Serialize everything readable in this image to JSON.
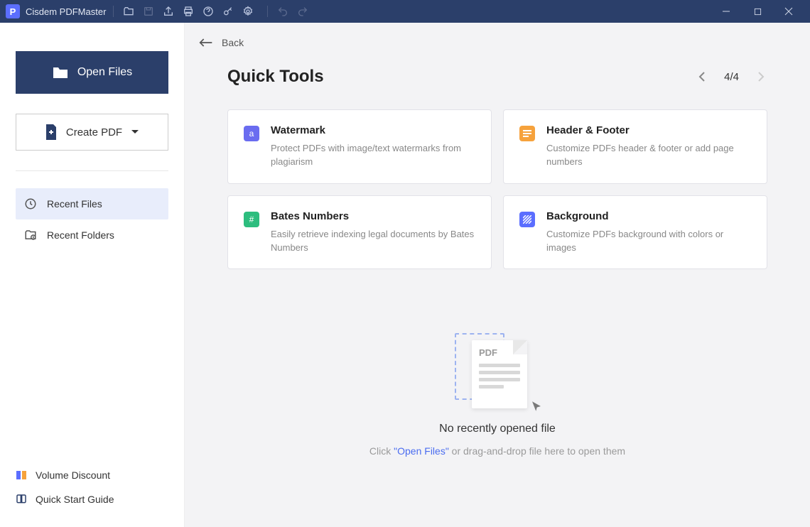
{
  "app": {
    "title": "Cisdem PDFMaster",
    "icon_letter": "P"
  },
  "titlebar_icons": [
    "open-icon",
    "save-icon",
    "share-icon",
    "print-icon",
    "help-icon",
    "upgrade-key-icon",
    "settings-gear-icon",
    "undo-icon",
    "redo-icon"
  ],
  "sidebar": {
    "open_files": "Open Files",
    "create_pdf": "Create PDF",
    "nav": [
      {
        "id": "recent-files",
        "label": "Recent Files",
        "active": true
      },
      {
        "id": "recent-folders",
        "label": "Recent Folders",
        "active": false
      }
    ],
    "bottom": [
      {
        "id": "volume-discount",
        "label": "Volume Discount"
      },
      {
        "id": "quick-start-guide",
        "label": "Quick Start Guide"
      }
    ]
  },
  "main": {
    "back": "Back",
    "heading": "Quick Tools",
    "pager": {
      "current": 4,
      "total": 4,
      "display": "4/4"
    },
    "tools": [
      {
        "id": "watermark",
        "title": "Watermark",
        "desc": "Protect PDFs with image/text watermarks from plagiarism",
        "color": "#6a6cf0",
        "glyph": "a"
      },
      {
        "id": "header-footer",
        "title": "Header & Footer",
        "desc": "Customize PDFs header & footer or add page numbers",
        "color": "#f6a23c",
        "glyph": "≡"
      },
      {
        "id": "bates-numbers",
        "title": "Bates Numbers",
        "desc": "Easily retrieve indexing legal documents by Bates Numbers",
        "color": "#2dbd7e",
        "glyph": "#"
      },
      {
        "id": "background",
        "title": "Background",
        "desc": "Customize PDFs background with colors or images",
        "color": "#5b6eff",
        "glyph": "▨"
      }
    ],
    "empty": {
      "pdf_label": "PDF",
      "title": "No recently opened file",
      "prefix": "Click ",
      "link": "\"Open Files\"",
      "suffix": " or drag-and-drop file here to open them"
    }
  }
}
